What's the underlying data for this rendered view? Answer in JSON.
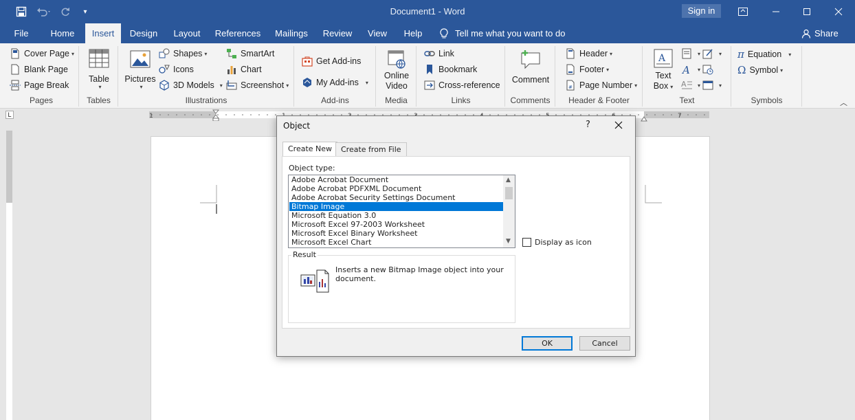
{
  "window": {
    "title": "Document1 - Word",
    "sign_in": "Sign in",
    "share": "Share"
  },
  "tabs": [
    "File",
    "Home",
    "Insert",
    "Design",
    "Layout",
    "References",
    "Mailings",
    "Review",
    "View",
    "Help"
  ],
  "active_tab": "Insert",
  "tell_me": "Tell me what you want to do",
  "ribbon": {
    "pages": {
      "label": "Pages",
      "items": [
        "Cover Page",
        "Blank Page",
        "Page Break"
      ]
    },
    "tables": {
      "label": "Tables",
      "table": "Table"
    },
    "illustrations": {
      "label": "Illustrations",
      "pictures": "Pictures",
      "shapes": "Shapes",
      "icons": "Icons",
      "models": "3D Models",
      "smartart": "SmartArt",
      "chart": "Chart",
      "screenshot": "Screenshot"
    },
    "addins": {
      "label": "Add-ins",
      "get": "Get Add-ins",
      "my": "My Add-ins"
    },
    "media": {
      "label": "Media",
      "online_video_1": "Online",
      "online_video_2": "Video"
    },
    "links": {
      "label": "Links",
      "link": "Link",
      "bookmark": "Bookmark",
      "crossref": "Cross-reference"
    },
    "comments": {
      "label": "Comments",
      "comment": "Comment"
    },
    "headerfooter": {
      "label": "Header & Footer",
      "header": "Header",
      "footer": "Footer",
      "pagenumber": "Page Number"
    },
    "text": {
      "label": "Text",
      "textbox_1": "Text",
      "textbox_2": "Box"
    },
    "symbols": {
      "label": "Symbols",
      "equation": "Equation",
      "symbol": "Symbol"
    }
  },
  "ruler": {
    "numbers": [
      "1",
      "1",
      "2",
      "3",
      "4",
      "5",
      "6",
      "7"
    ]
  },
  "dialog": {
    "title": "Object",
    "help": "?",
    "tabs": [
      "Create New",
      "Create from File"
    ],
    "object_type_label": "Object type:",
    "object_types": [
      "Adobe Acrobat Document",
      "Adobe Acrobat PDFXML Document",
      "Adobe Acrobat Security Settings Document",
      "Bitmap Image",
      "Microsoft Equation 3.0",
      "Microsoft Excel 97-2003 Worksheet",
      "Microsoft Excel Binary Worksheet",
      "Microsoft Excel Chart"
    ],
    "selected_type": "Bitmap Image",
    "display_as_icon": "Display as icon",
    "display_as_icon_checked": false,
    "result_label": "Result",
    "result_text": "Inserts a new Bitmap Image object into your document.",
    "ok": "OK",
    "cancel": "Cancel"
  },
  "colors": {
    "accent": "#2b579a",
    "selection": "#0078d7"
  }
}
